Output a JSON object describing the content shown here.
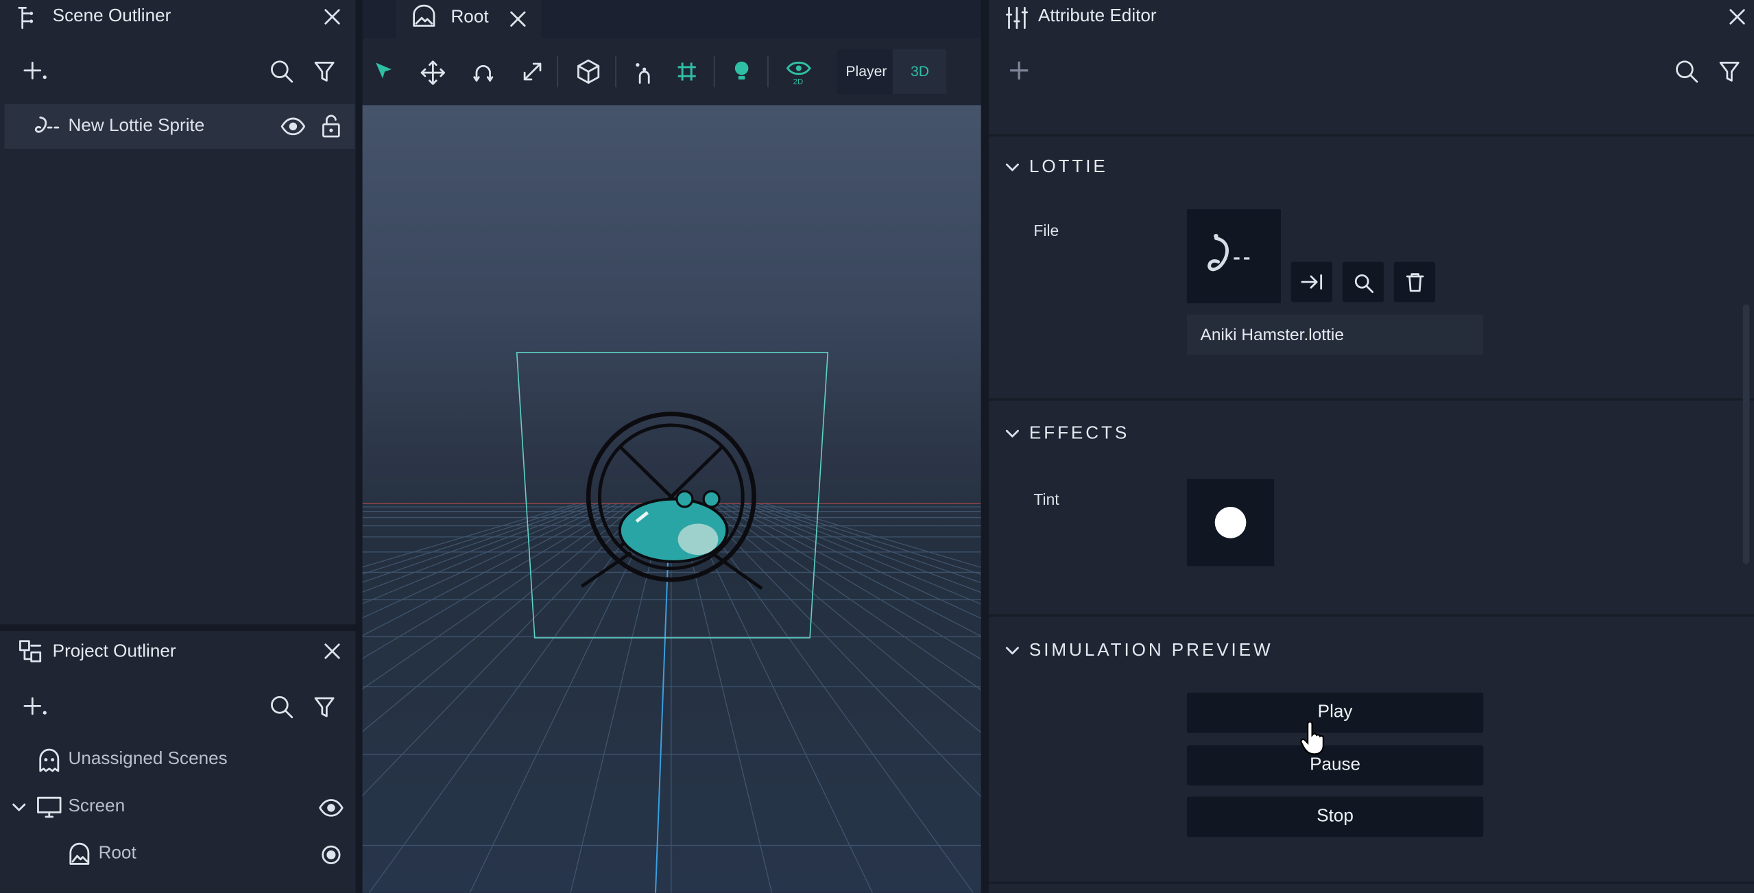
{
  "scene_outliner": {
    "title": "Scene Outliner",
    "items": [
      {
        "label": "New Lottie Sprite"
      }
    ]
  },
  "project_outliner": {
    "title": "Project Outliner",
    "items": [
      {
        "label": "Unassigned Scenes"
      },
      {
        "label": "Screen"
      },
      {
        "label": "Root"
      }
    ]
  },
  "viewport": {
    "tab_label": "Root",
    "toolbar": {
      "player_label": "Player",
      "mode_label": "3D"
    }
  },
  "attribute_editor": {
    "title": "Attribute Editor",
    "sections": {
      "lottie": {
        "title": "LOTTIE",
        "file_label": "File",
        "file_name": "Aniki Hamster.lottie"
      },
      "effects": {
        "title": "EFFECTS",
        "tint_label": "Tint",
        "tint_color": "#ffffff"
      },
      "simulation": {
        "title": "SIMULATION PREVIEW",
        "play_label": "Play",
        "pause_label": "Pause",
        "stop_label": "Stop"
      }
    }
  },
  "colors": {
    "accent": "#3ec9c4",
    "panel": "#1b2130",
    "button": "#111722",
    "active_tool": "#2fbfa5"
  }
}
